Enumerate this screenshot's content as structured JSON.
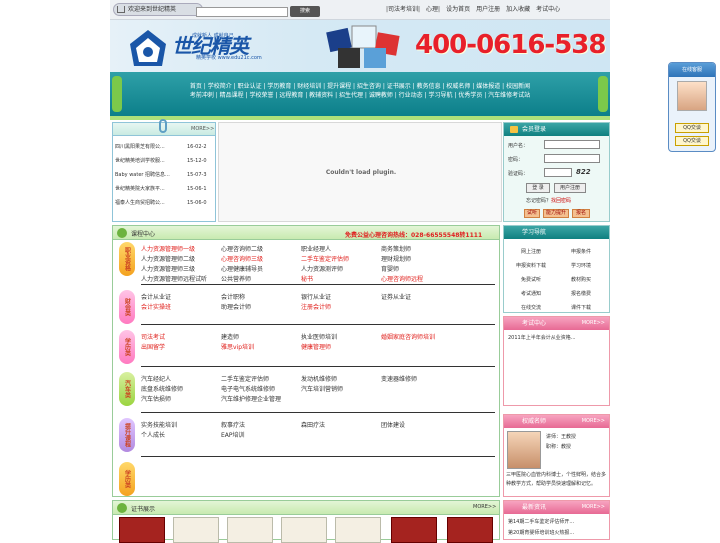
{
  "topbar": {
    "welcome": "欢迎来到世纪精英",
    "search_button": "搜索",
    "links": [
      "|司法考培训|",
      "心理|",
      "设为首页",
      "用户注册",
      "加入收藏",
      "考试中心"
    ]
  },
  "header": {
    "logo_text": "世纪精英",
    "slogan": "成就新人  成就自己",
    "url": "精英学校 www.edu21c.com",
    "phone": "400-0616-538"
  },
  "nav": {
    "row1": "首页 | 学校简介 | 职业认证 | 学历教育 | 财经培训 | 提升课程 | 招生咨询 | 证书展示 | 教务信息 | 权威名师 | 媒体报道 | 校园新闻",
    "row2": "考前冲刺 | 精品课程 | 学校荣誉 | 远程教育 | 教辅资料 | 招生代理 | 诚聘教师 | 行业动态 | 学习导航 | 优秀学员 | 汽车维修考试站"
  },
  "news": {
    "more": "MORE>>",
    "items": [
      {
        "title": "四川黑阳果芝有限公...",
        "date": "16-02-2"
      },
      {
        "title": "世纪精英培训学校服...",
        "date": "15-12-0"
      },
      {
        "title": "Baby water 招聘信息...",
        "date": "15-07-3"
      },
      {
        "title": "世纪精英院大家族平...",
        "date": "15-06-1"
      },
      {
        "title": "福泰人生商贸招聘公...",
        "date": "15-06-0"
      }
    ]
  },
  "plugin": {
    "message": "Couldn't load plugin."
  },
  "login": {
    "title": "会员登录",
    "username_label": "用户名：",
    "password_label": "密码：",
    "code_label": "验证码：",
    "code_value": "822",
    "login_button": "登 录",
    "register_button": "用户注册",
    "forgot_prefix": "忘记密码？",
    "forgot_link": "找回密码",
    "small_buttons": [
      "试听",
      "能力提升",
      "报名"
    ]
  },
  "course": {
    "title": "课程中心",
    "hotline": "免费公益心理咨询热线：028-66555548转1111",
    "categories": [
      {
        "label": "职业资格",
        "color": "yellow",
        "rows": [
          [
            {
              "t": "人力资源管理师一级",
              "red": true
            },
            {
              "t": "心理咨询师二级",
              "red": false
            },
            {
              "t": "职业经理人",
              "red": false
            },
            {
              "t": "商务策划师",
              "red": false
            }
          ],
          [
            {
              "t": "人力资源管理师二级",
              "red": false
            },
            {
              "t": "心理咨询师三级",
              "red": true
            },
            {
              "t": "二手车鉴定评估师",
              "red": true
            },
            {
              "t": "理财规划师",
              "red": false
            }
          ],
          [
            {
              "t": "人力资源管理师三级",
              "red": false
            },
            {
              "t": "心理健康辅导员",
              "red": false
            },
            {
              "t": "人力资源测评师",
              "red": false
            },
            {
              "t": "育婴师",
              "red": false
            }
          ],
          [
            {
              "t": "人力资源管理师远程试听",
              "red": false
            },
            {
              "t": "公共营养师",
              "red": false
            },
            {
              "t": "秘书",
              "red": true
            },
            {
              "t": "心理咨询师远程",
              "red": true
            }
          ]
        ]
      },
      {
        "label": "财会类",
        "color": "pink",
        "rows": [
          [
            {
              "t": "会计从业证",
              "red": false
            },
            {
              "t": "会计职称",
              "red": false
            },
            {
              "t": "银行从业证",
              "red": false
            },
            {
              "t": "证券从业证",
              "red": false
            }
          ],
          [
            {
              "t": "会计实操班",
              "red": true
            },
            {
              "t": "助理会计师",
              "red": false
            },
            {
              "t": "注册会计师",
              "red": true
            },
            {
              "t": "",
              "red": false
            }
          ]
        ]
      },
      {
        "label": "学历类",
        "color": "pink",
        "rows": [
          [
            {
              "t": "司法考试",
              "red": true
            },
            {
              "t": "建造师",
              "red": false
            },
            {
              "t": "执业医师培训",
              "red": false
            },
            {
              "t": "婚姻家庭咨询师培训",
              "red": true
            }
          ],
          [
            {
              "t": "出国留学",
              "red": true
            },
            {
              "t": "雅思vip培训",
              "red": true
            },
            {
              "t": "健康管理师",
              "red": true
            },
            {
              "t": "",
              "red": false
            }
          ]
        ]
      },
      {
        "label": "汽车类",
        "color": "green",
        "rows": [
          [
            {
              "t": "汽车经纪人",
              "red": false
            },
            {
              "t": "二手车鉴定评估师",
              "red": false
            },
            {
              "t": "发动机维修师",
              "red": false
            },
            {
              "t": "变速器维修师",
              "red": false
            }
          ],
          [
            {
              "t": "底盘系统维修师",
              "red": false
            },
            {
              "t": "电子电气系统维修师",
              "red": false
            },
            {
              "t": "汽车培训营销师",
              "red": false
            },
            {
              "t": "",
              "red": false
            }
          ],
          [
            {
              "t": "汽车估损师",
              "red": false
            },
            {
              "t": "汽车维护修理企业管理",
              "red": false
            },
            {
              "t": "",
              "red": false
            },
            {
              "t": "",
              "red": false
            }
          ]
        ]
      },
      {
        "label": "提升课程",
        "color": "purple",
        "rows": [
          [
            {
              "t": "实务技能培训",
              "red": false
            },
            {
              "t": "叙事疗法",
              "red": false
            },
            {
              "t": "森田疗法",
              "red": false
            },
            {
              "t": "团体建设",
              "red": false
            }
          ],
          [
            {
              "t": "个人成长",
              "red": false
            },
            {
              "t": "EAP培训",
              "red": false
            },
            {
              "t": "",
              "red": false
            },
            {
              "t": "",
              "red": false
            }
          ]
        ]
      },
      {
        "label": "学历类",
        "color": "yellow",
        "rows": []
      }
    ]
  },
  "study": {
    "title": "学习导航",
    "items": [
      "网上注册",
      "申报条件",
      "申报资料下载",
      "学习环境",
      "免费试听",
      "教材购买",
      "考试通知",
      "报名缴费",
      "在线交流",
      "课件下载"
    ]
  },
  "exam": {
    "title": "考试中心",
    "more": "MORE>>",
    "items": [
      "2011年上半年会计从业资格..."
    ]
  },
  "teacher": {
    "title": "权威名师",
    "more": "MORE>>",
    "name": "讲师：王教授",
    "rank": "职称：教授",
    "desc": "三甲医院心血管内科博士，个性鲜明，结合多种教学方式，帮助学员快速理解和记忆。"
  },
  "certs": {
    "title": "证书展示",
    "more": "MORE>>"
  },
  "latest": {
    "title": "最新资讯",
    "more": "MORE>>",
    "items": [
      "第14期二手车鉴定评估师开...",
      "第20期育婴师培训班火热报..."
    ]
  },
  "float": {
    "title": "在线客服",
    "qq1": "QQ交谈",
    "qq2": "QQ交谈"
  }
}
